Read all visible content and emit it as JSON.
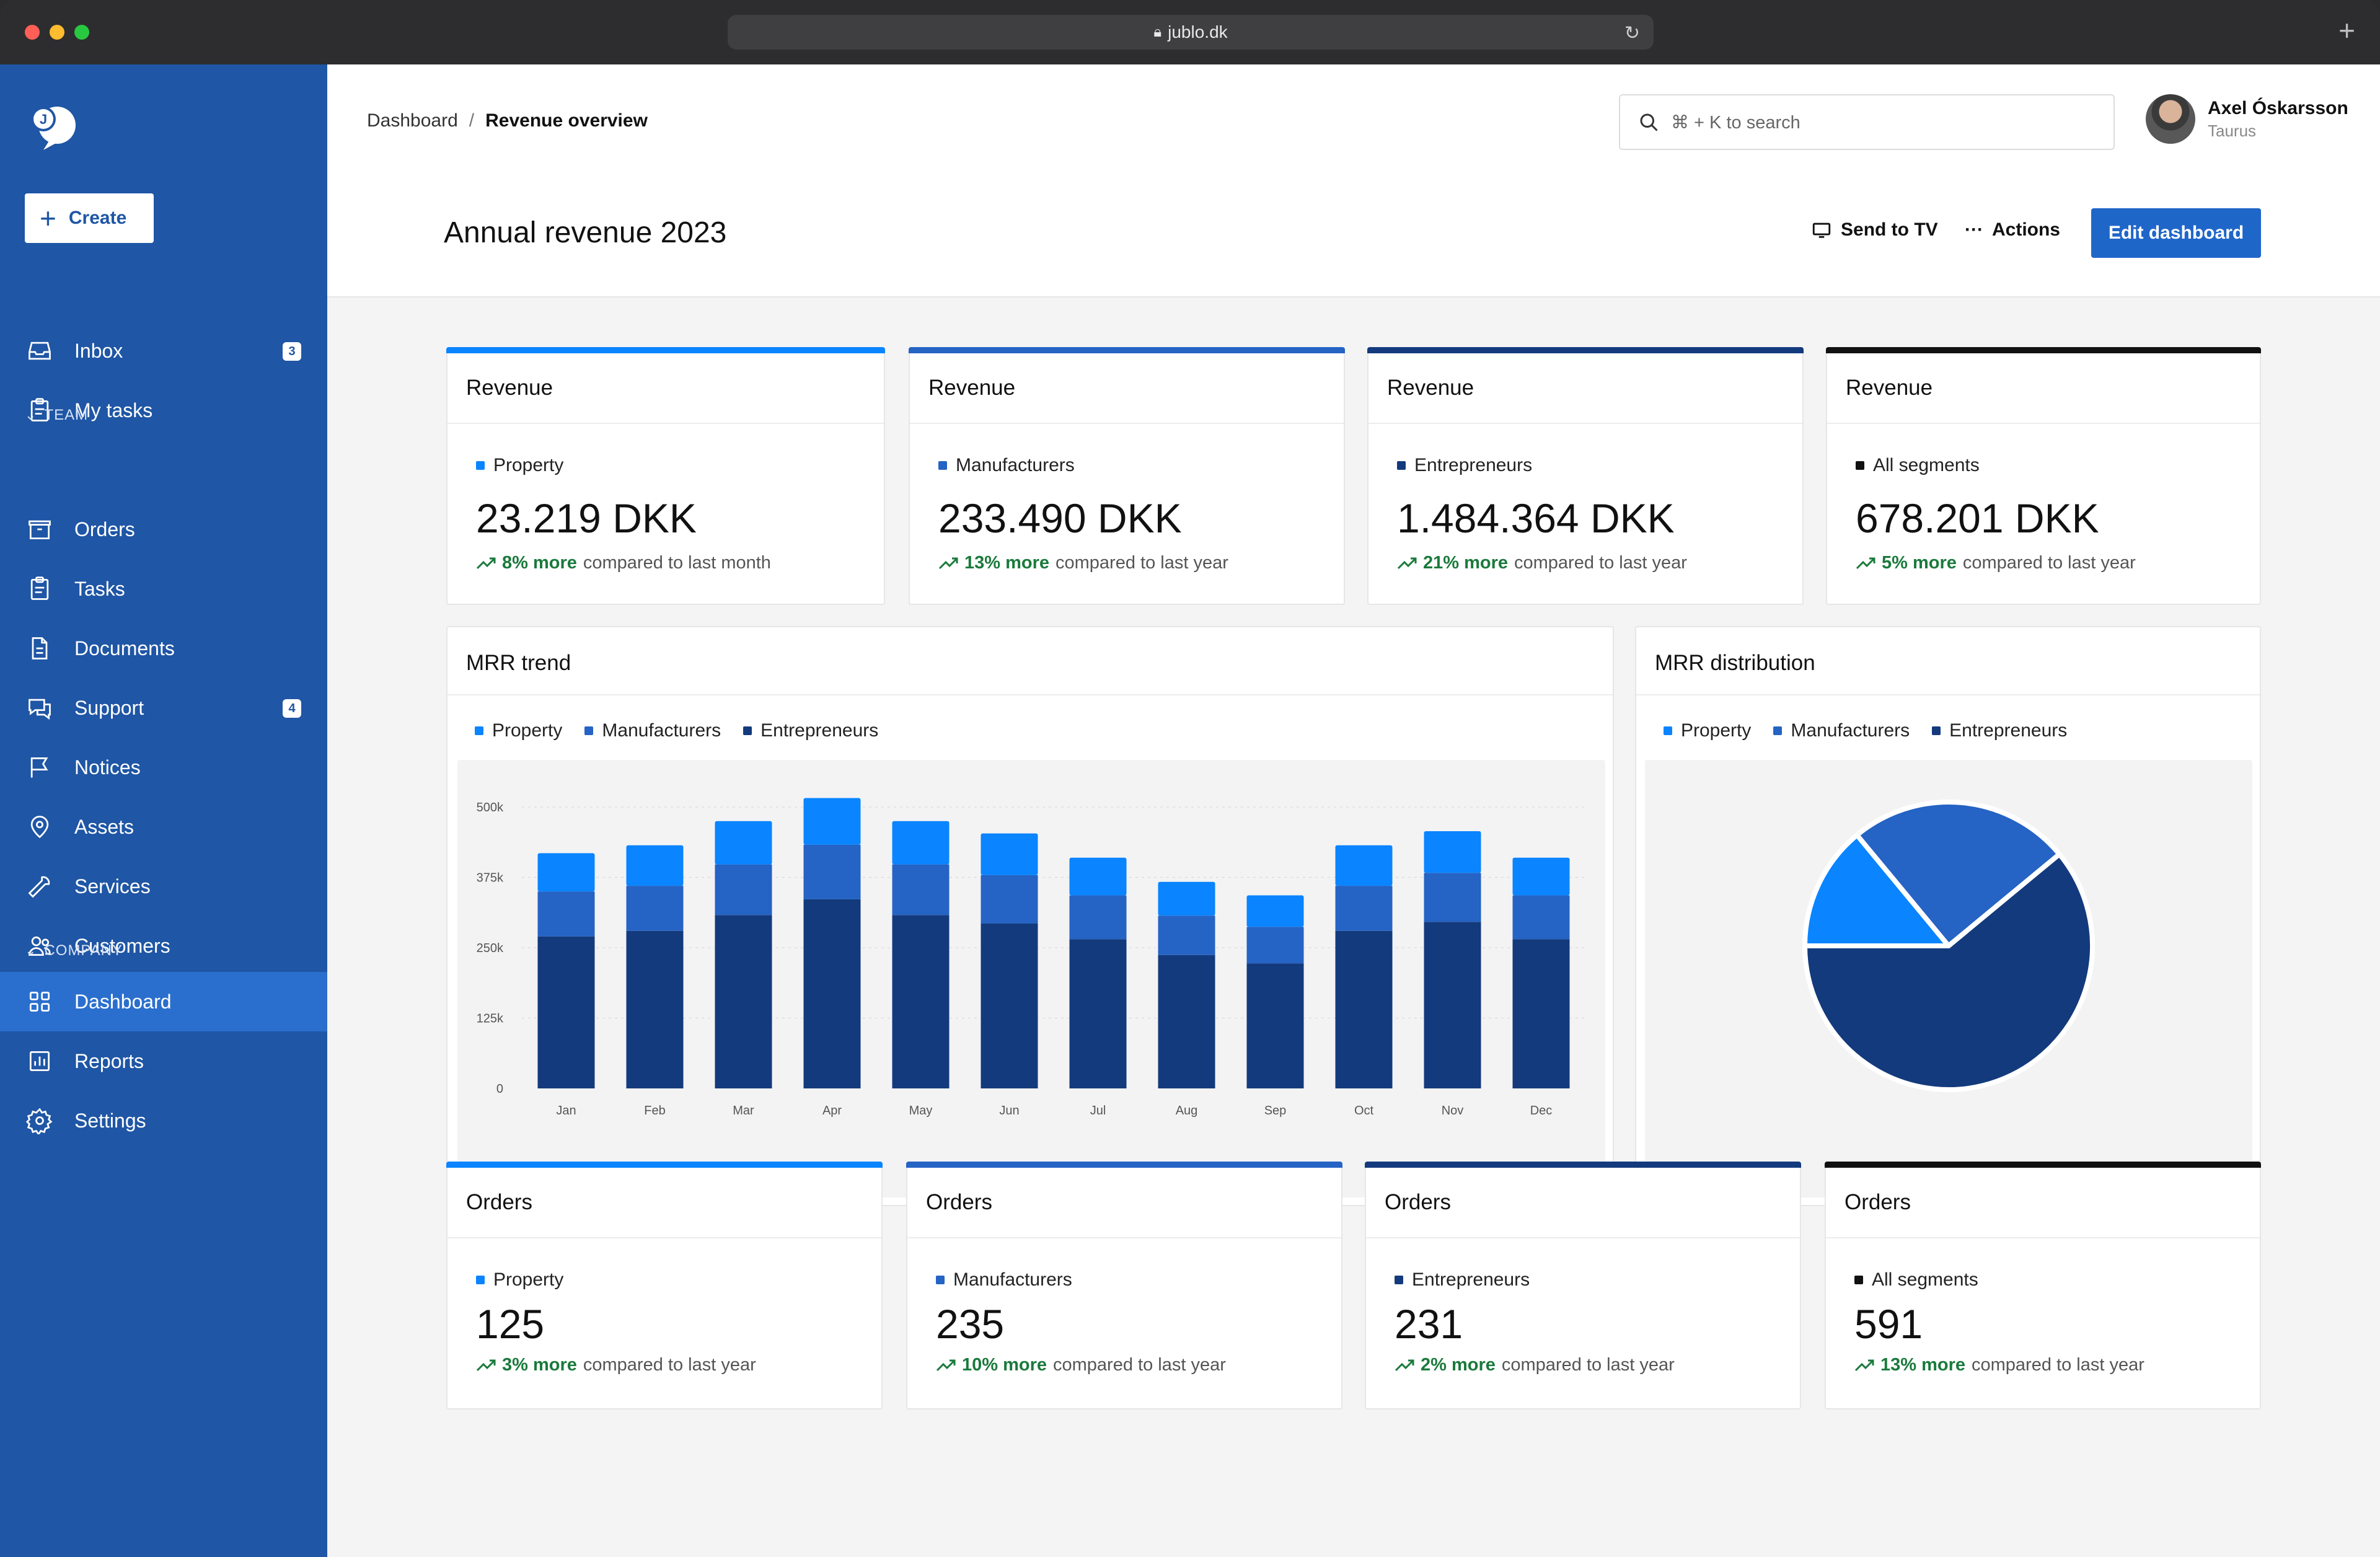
{
  "browser": {
    "url": "jublo.dk"
  },
  "sidebar": {
    "create_label": "Create",
    "items": [
      {
        "label": "Inbox",
        "icon": "inbox-icon",
        "badge": "3"
      },
      {
        "label": "My tasks",
        "icon": "clipboard-icon"
      }
    ],
    "team_label": "TEAM",
    "team_items": [
      {
        "label": "Orders",
        "icon": "box-icon"
      },
      {
        "label": "Tasks",
        "icon": "clipboard-icon"
      },
      {
        "label": "Documents",
        "icon": "document-icon"
      },
      {
        "label": "Support",
        "icon": "chat-icon",
        "badge": "4"
      },
      {
        "label": "Notices",
        "icon": "flag-icon"
      },
      {
        "label": "Assets",
        "icon": "location-pin-icon"
      },
      {
        "label": "Services",
        "icon": "wrench-icon"
      },
      {
        "label": "Customers",
        "icon": "users-icon"
      }
    ],
    "company_label": "COMPANY",
    "company_items": [
      {
        "label": "Dashboard",
        "icon": "grid-icon",
        "active": true
      },
      {
        "label": "Reports",
        "icon": "chart-icon"
      },
      {
        "label": "Settings",
        "icon": "gear-icon"
      }
    ]
  },
  "header": {
    "breadcrumb_root": "Dashboard",
    "breadcrumb_sep": "/",
    "breadcrumb_current": "Revenue overview",
    "search_placeholder": "⌘ + K to search",
    "user_name": "Axel Óskarsson",
    "user_subtitle": "Taurus",
    "page_title": "Annual revenue 2023",
    "send_to_tv": "Send to TV",
    "actions": "Actions",
    "edit_dashboard": "Edit dashboard"
  },
  "colors": {
    "property": "#0a84ff",
    "manufacturers": "#2563c4",
    "entrepreneurs": "#133a7c",
    "all": "#111111",
    "sidebar": "#1f56a5",
    "positive": "#1a7a3c"
  },
  "revenue_cards": [
    {
      "title": "Revenue",
      "segment": "Property",
      "value": "23.219 DKK",
      "delta": "8% more",
      "compare": "compared to last month"
    },
    {
      "title": "Revenue",
      "segment": "Manufacturers",
      "value": "233.490 DKK",
      "delta": "13% more",
      "compare": "compared to last year"
    },
    {
      "title": "Revenue",
      "segment": "Entrepreneurs",
      "value": "1.484.364 DKK",
      "delta": "21% more",
      "compare": "compared to last year"
    },
    {
      "title": "Revenue",
      "segment": "All segments",
      "value": "678.201 DKK",
      "delta": "5% more",
      "compare": "compared to last year"
    }
  ],
  "order_cards": [
    {
      "title": "Orders",
      "segment": "Property",
      "value": "125",
      "delta": "3% more",
      "compare": "compared to last year"
    },
    {
      "title": "Orders",
      "segment": "Manufacturers",
      "value": "235",
      "delta": "10% more",
      "compare": "compared to last year"
    },
    {
      "title": "Orders",
      "segment": "Entrepreneurs",
      "value": "231",
      "delta": "2% more",
      "compare": "compared to last year"
    },
    {
      "title": "Orders",
      "segment": "All segments",
      "value": "591",
      "delta": "13% more",
      "compare": "compared to last year"
    }
  ],
  "mrr_trend": {
    "title": "MRR trend",
    "legend": [
      "Property",
      "Manufacturers",
      "Entrepreneurs"
    ]
  },
  "mrr_distribution": {
    "title": "MRR distribution",
    "legend": [
      "Property",
      "Manufacturers",
      "Entrepreneurs"
    ]
  },
  "chart_data": [
    {
      "type": "bar",
      "stacked": true,
      "categories": [
        "Jan",
        "Feb",
        "Mar",
        "Apr",
        "May",
        "Jun",
        "Jul",
        "Aug",
        "Sep",
        "Oct",
        "Nov",
        "Dec"
      ],
      "series": [
        {
          "name": "Entrepreneurs",
          "values": [
            270000,
            280000,
            308000,
            336000,
            308000,
            293000,
            265000,
            237000,
            222000,
            280000,
            296000,
            265000
          ]
        },
        {
          "name": "Manufacturers",
          "values": [
            80000,
            80000,
            90000,
            97000,
            90000,
            86000,
            78000,
            70000,
            65000,
            80000,
            87000,
            78000
          ]
        },
        {
          "name": "Property",
          "values": [
            68000,
            72000,
            77000,
            83000,
            77000,
            74000,
            67000,
            60000,
            56000,
            72000,
            74000,
            67000
          ]
        }
      ],
      "yticks": [
        "0",
        "125k",
        "250k",
        "375k",
        "500k"
      ],
      "ylim": [
        0,
        500000
      ],
      "grid": true
    },
    {
      "type": "pie",
      "labels": [
        "Property",
        "Manufacturers",
        "Entrepreneurs"
      ],
      "values": [
        14,
        25,
        61
      ]
    }
  ]
}
